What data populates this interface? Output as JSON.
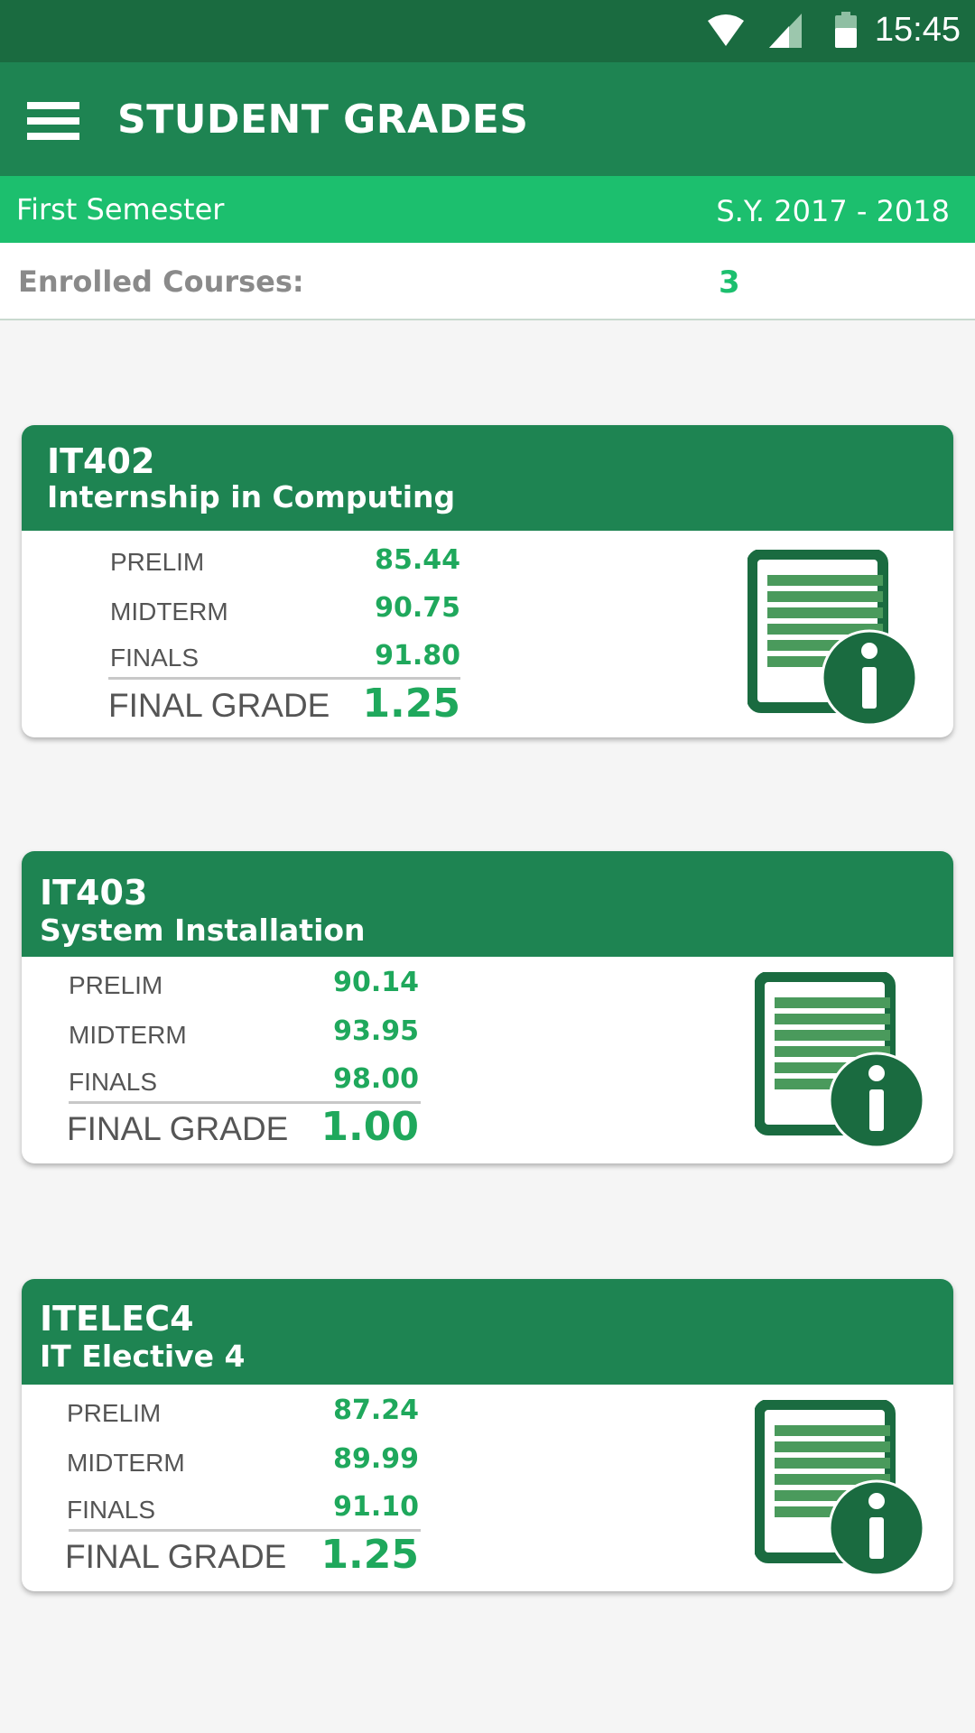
{
  "status_bar": {
    "time": "15:45"
  },
  "app_bar": {
    "title": "STUDENT GRADES"
  },
  "semester": {
    "label": "First Semester",
    "school_year": "S.Y. 2017 - 2018"
  },
  "enrolled": {
    "label": "Enrolled Courses:",
    "count": "3"
  },
  "grade_labels": {
    "prelim": "PRELIM",
    "midterm": "MIDTERM",
    "finals": "FINALS",
    "final_grade": "FINAL GRADE"
  },
  "courses": [
    {
      "code": "IT402",
      "name": "Internship in Computing",
      "prelim": "85.44",
      "midterm": "90.75",
      "finals": "91.80",
      "final_grade": "1.25"
    },
    {
      "code": "IT403",
      "name": "System Installation",
      "prelim": "90.14",
      "midterm": "93.95",
      "finals": "98.00",
      "final_grade": "1.00"
    },
    {
      "code": "ITELEC4",
      "name": "IT Elective 4",
      "prelim": "87.24",
      "midterm": "89.99",
      "finals": "91.10",
      "final_grade": "1.25"
    }
  ],
  "colors": {
    "dark_green": "#1a6b40",
    "header_green": "#1e8452",
    "bright_green": "#1cbf6e",
    "grade_green": "#1fa85c"
  }
}
